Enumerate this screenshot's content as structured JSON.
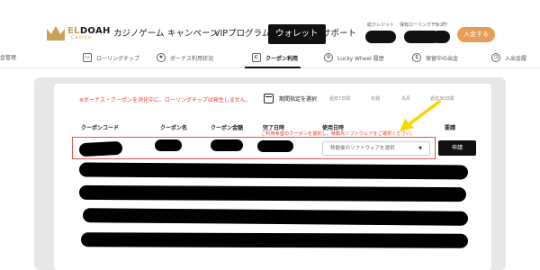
{
  "brand": {
    "name_prefix": "EL",
    "name_rest": "DOAH",
    "tagline": "Casino",
    "color": "#c9a157"
  },
  "nav": {
    "items": [
      "カジノゲーム",
      "キャンペーン",
      "VIPプログラム",
      "ウォレット",
      "サポート"
    ],
    "active": "ウォレット"
  },
  "account": {
    "credit_label": "総クレジット",
    "rolling_label": "保有ローリングチップ",
    "rank_label": "ランク",
    "deposit_button": "入金する",
    "accent": "#e89c55"
  },
  "subtabs": {
    "items": [
      {
        "label": "出金管理",
        "icon": "withdraw-icon"
      },
      {
        "label": "ローリングチップ",
        "icon": "chip-icon"
      },
      {
        "label": "ボーナス利用状況",
        "icon": "bonus-icon"
      },
      {
        "label": "クーポン利用",
        "icon": "coupon-icon"
      },
      {
        "label": "Lucky Wheel 履歴",
        "icon": "wheel-icon"
      },
      {
        "label": "保留中の出金",
        "icon": "pending-icon"
      },
      {
        "label": "入出金履",
        "icon": "clock-icon"
      }
    ],
    "active": "クーポン利用"
  },
  "coupon": {
    "notice": "※ボーナス・クーポンを消化中に、ローリングチップは発生しません。",
    "period_label": "期間指定を選択",
    "period_options": [
      "過去7日間",
      "先週",
      "先月",
      "過去30日間"
    ],
    "columns": [
      "クーポンコード",
      "クーポン名",
      "クーポン金額",
      "完了日時",
      "使用日時",
      "要請"
    ],
    "hint": "ご利用希望のクーポンを選択し、移動先ソフトウェアをご選択ください。",
    "select_placeholder": "移動後のソフトウェアを選択",
    "apply_button": "申請",
    "alert_color": "#e83a2b"
  },
  "annotation": {
    "arrow_color": "#f5d800"
  }
}
